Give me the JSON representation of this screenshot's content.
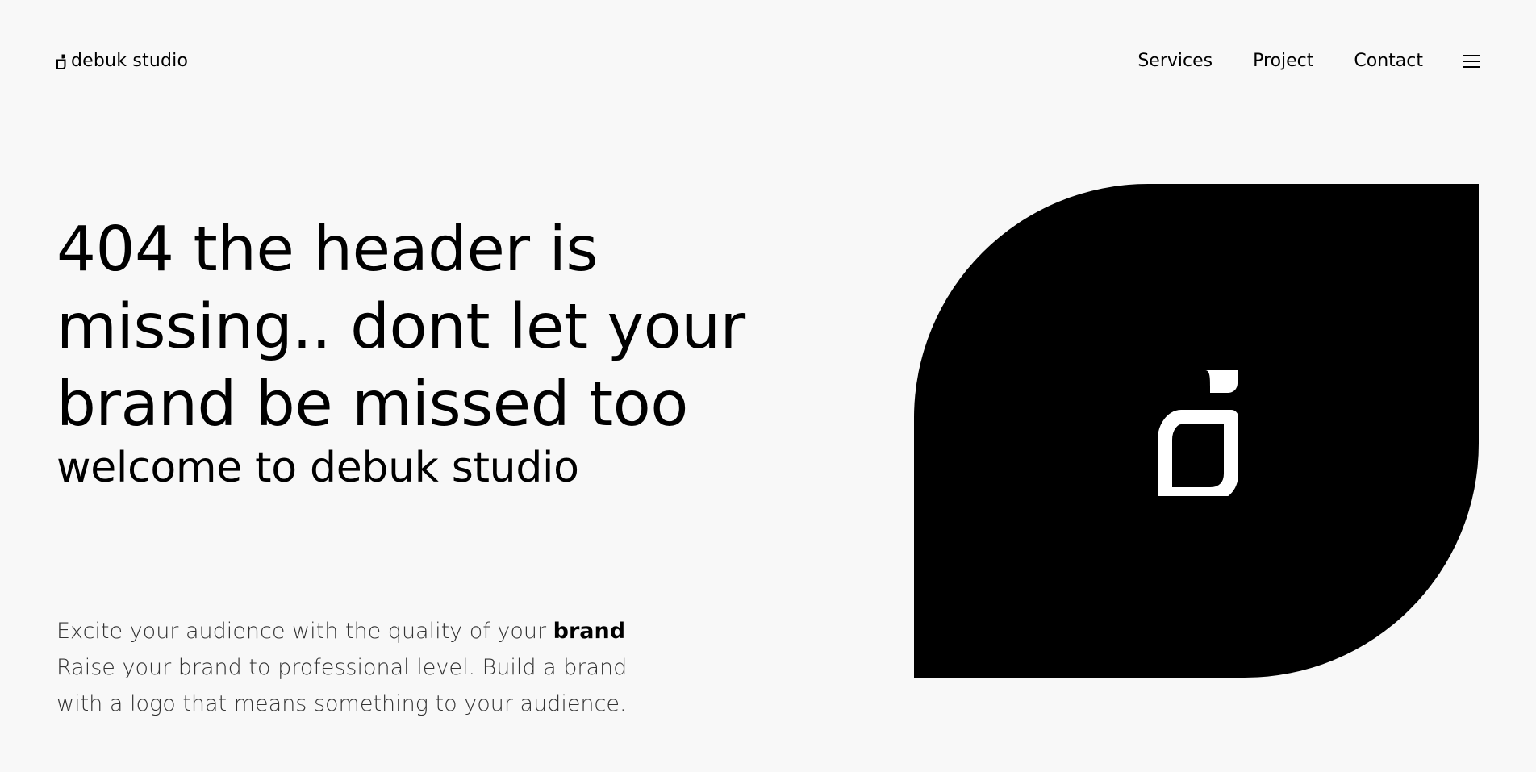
{
  "header": {
    "brand_name": "debuk studio",
    "brand_icon": "debuk-logo-icon",
    "nav": [
      {
        "label": "Services"
      },
      {
        "label": "Project"
      },
      {
        "label": "Contact"
      }
    ],
    "menu_icon": "hamburger-menu-icon"
  },
  "hero": {
    "title_lines": [
      "404 the header is",
      "missing.. dont let your",
      "brand be missed too"
    ],
    "subtitle": "welcome to debuk studio"
  },
  "description": {
    "line1_prefix": "Excite your audience with the quality of your ",
    "line1_bold": "brand",
    "line2": "Raise your brand to professional level. Build a brand",
    "line3": "with a logo that means something to your audience."
  },
  "visual": {
    "shape": "leaf",
    "fill_color": "#000000",
    "logo_color": "#ffffff",
    "background_color": "#f8f8f8"
  }
}
